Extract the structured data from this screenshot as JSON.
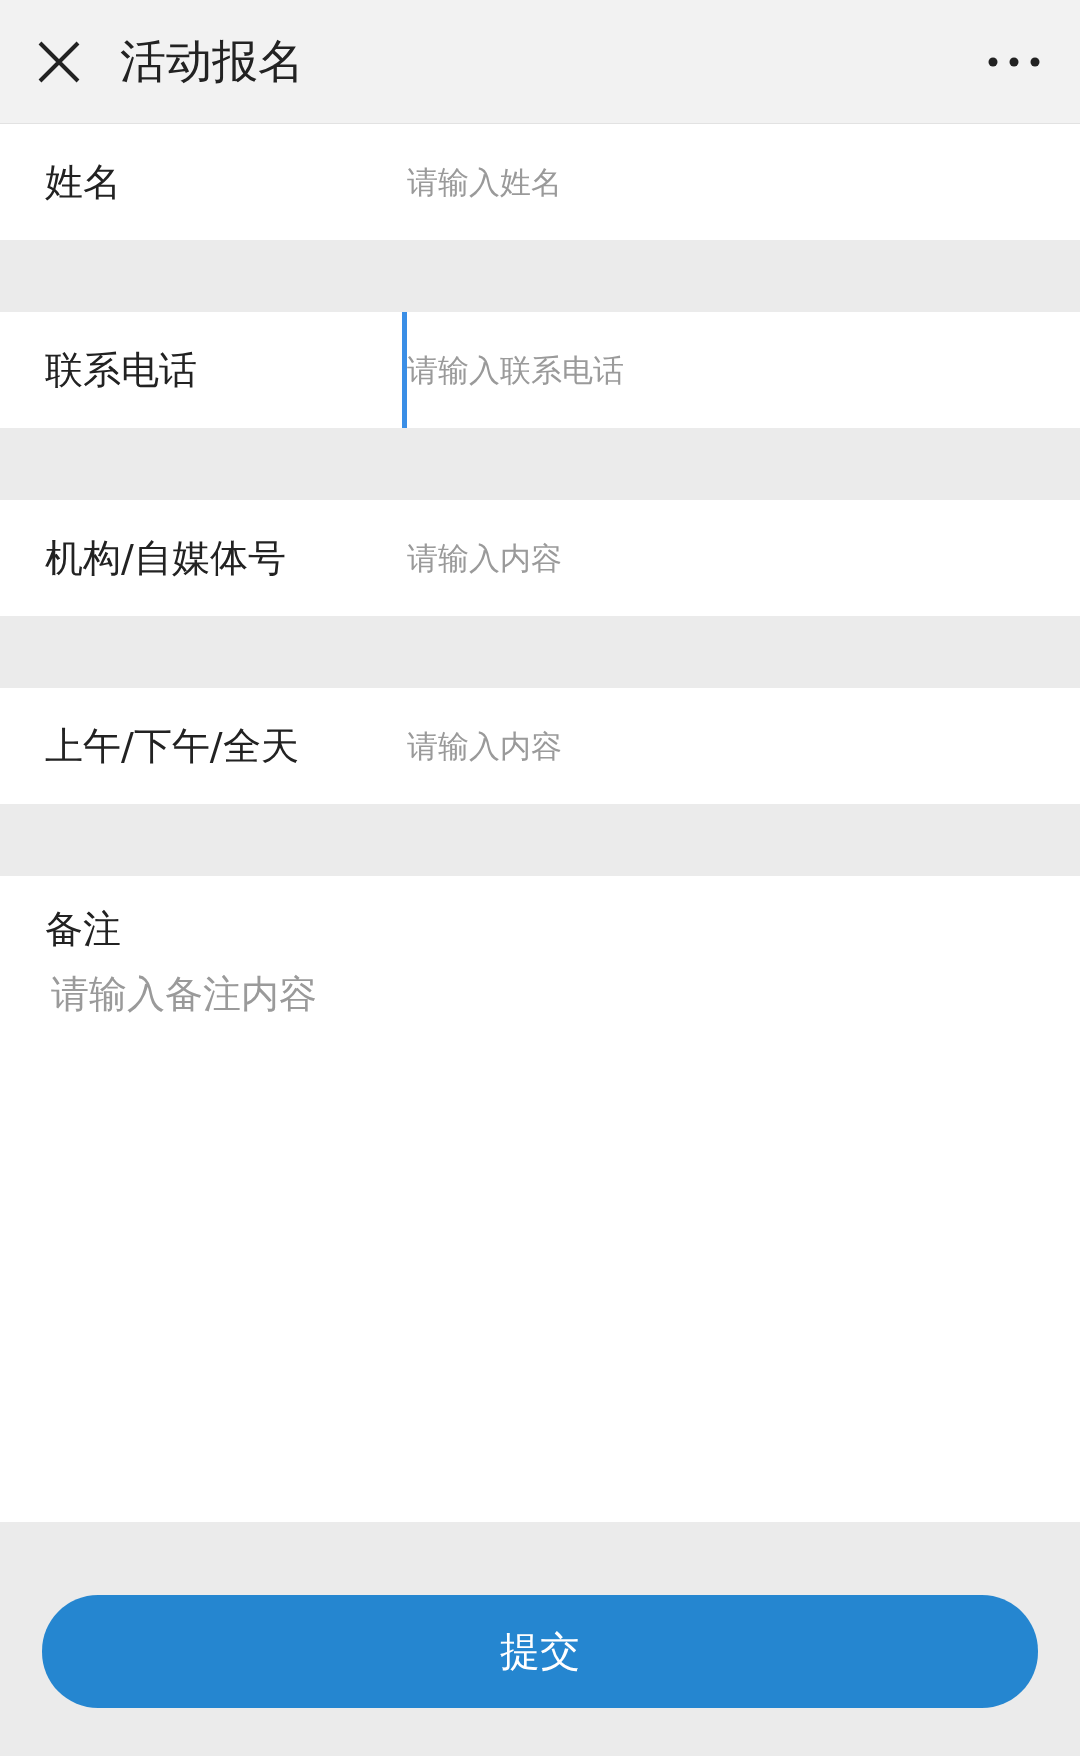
{
  "header": {
    "title": "活动报名"
  },
  "fields": [
    {
      "label": "姓名",
      "placeholder": "请输入姓名",
      "focused": false
    },
    {
      "label": "联系电话",
      "placeholder": "请输入联系电话",
      "focused": true
    },
    {
      "label": "机构/自媒体号",
      "placeholder": "请输入内容",
      "focused": false
    },
    {
      "label": "上午/下午/全天",
      "placeholder": "请输入内容",
      "focused": false
    }
  ],
  "notes": {
    "label": "备注",
    "placeholder": "请输入备注内容"
  },
  "submit_button": {
    "label": "提交"
  }
}
